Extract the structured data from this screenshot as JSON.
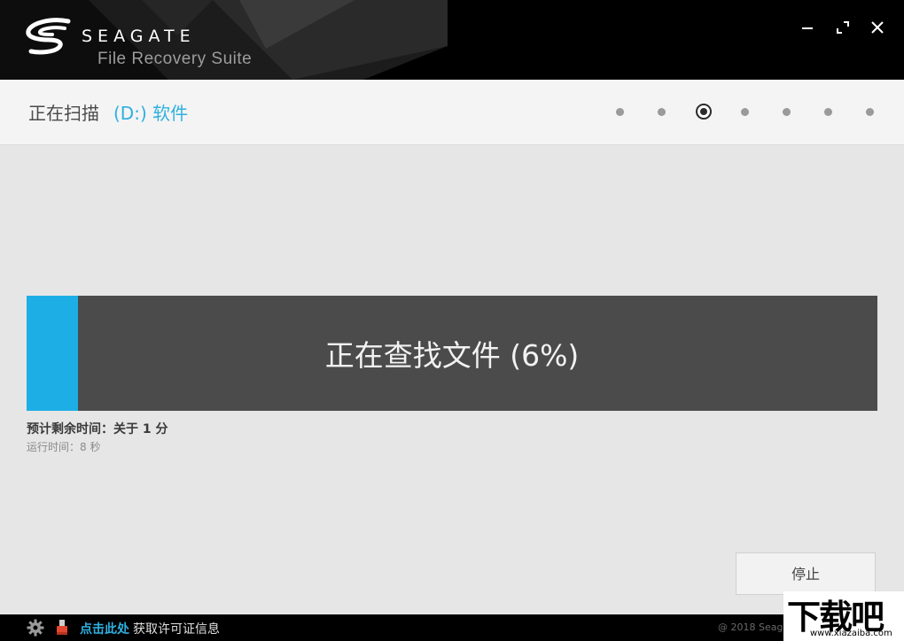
{
  "header": {
    "brand": "SEAGATE",
    "product": "File Recovery Suite",
    "logo_icon": "seagate-swirl-icon",
    "window_controls": [
      "minimize-icon",
      "maximize-icon",
      "close-icon"
    ]
  },
  "titlebar": {
    "label": "正在扫描",
    "drive": "(D:) 软件",
    "steps_total": 7,
    "current_step": 3
  },
  "progress": {
    "text": "正在查找文件 (6%)",
    "percent": 6,
    "eta": "预计剩余时间：关于 1 分",
    "elapsed": "运行时间：8 秒"
  },
  "actions": {
    "stop_label": "停止"
  },
  "footer": {
    "settings_icon": "gear-icon",
    "license_icon": "usb-key-icon",
    "link_label": "点击此处",
    "license_text": "获取许可证信息",
    "copyright": "@ 2018 Seaga"
  },
  "watermark": {
    "title": "下载吧",
    "url": "www.xiazaiba.com"
  },
  "colors": {
    "accent": "#1daee6",
    "progress_bg": "#4b4b4b",
    "header_bg": "#000000",
    "content_bg": "#e6e6e6"
  }
}
